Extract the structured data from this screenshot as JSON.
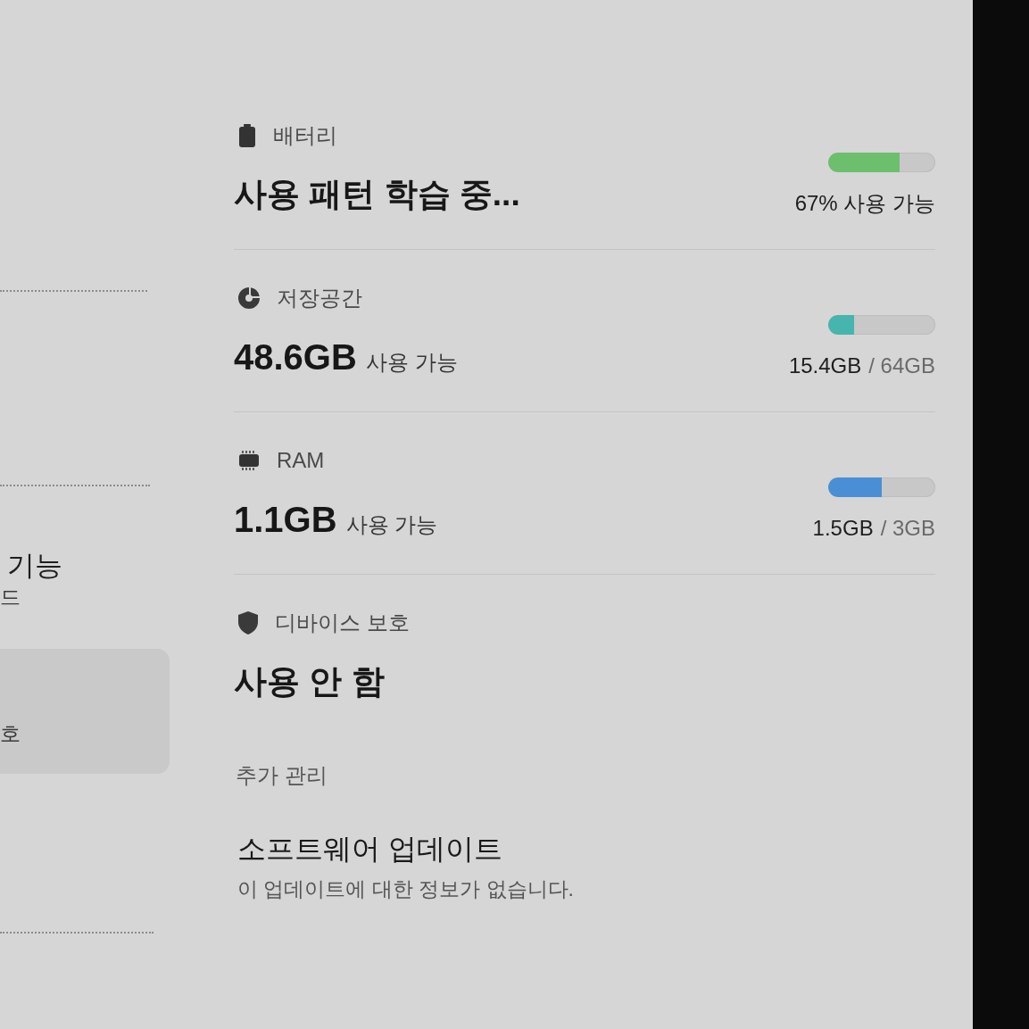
{
  "sidebar": {
    "items": [
      {
        "title": "기능",
        "subtitle": "드",
        "selected": false
      },
      {
        "subtitle": "호",
        "selected": true
      }
    ]
  },
  "status_items": [
    {
      "kind": "battery",
      "label": "배터리",
      "value": "사용 패턴 학습 중...",
      "level": 0.67,
      "color": "#6cbf6c",
      "reading": "67% 사용 가능"
    },
    {
      "kind": "storage",
      "label": "저장공간",
      "value": "48.6GB",
      "value_note": "사용 가능",
      "level": 0.24,
      "color": "#45b5ae",
      "reading": "15.4GB",
      "reading_total": "/ 64GB"
    },
    {
      "kind": "ram",
      "label": "RAM",
      "value": "1.1GB",
      "value_note": "사용 가능",
      "level": 0.5,
      "color": "#4a8fd6",
      "reading": "1.5GB",
      "reading_total": "/ 3GB"
    },
    {
      "kind": "protection",
      "label": "디바이스 보호",
      "value": "사용 안 함"
    }
  ],
  "more_section": {
    "header": "추가 관리",
    "items": [
      {
        "title": "소프트웨어 업데이트",
        "subtitle": "이 업데이트에 대한 정보가 없습니다."
      }
    ]
  }
}
